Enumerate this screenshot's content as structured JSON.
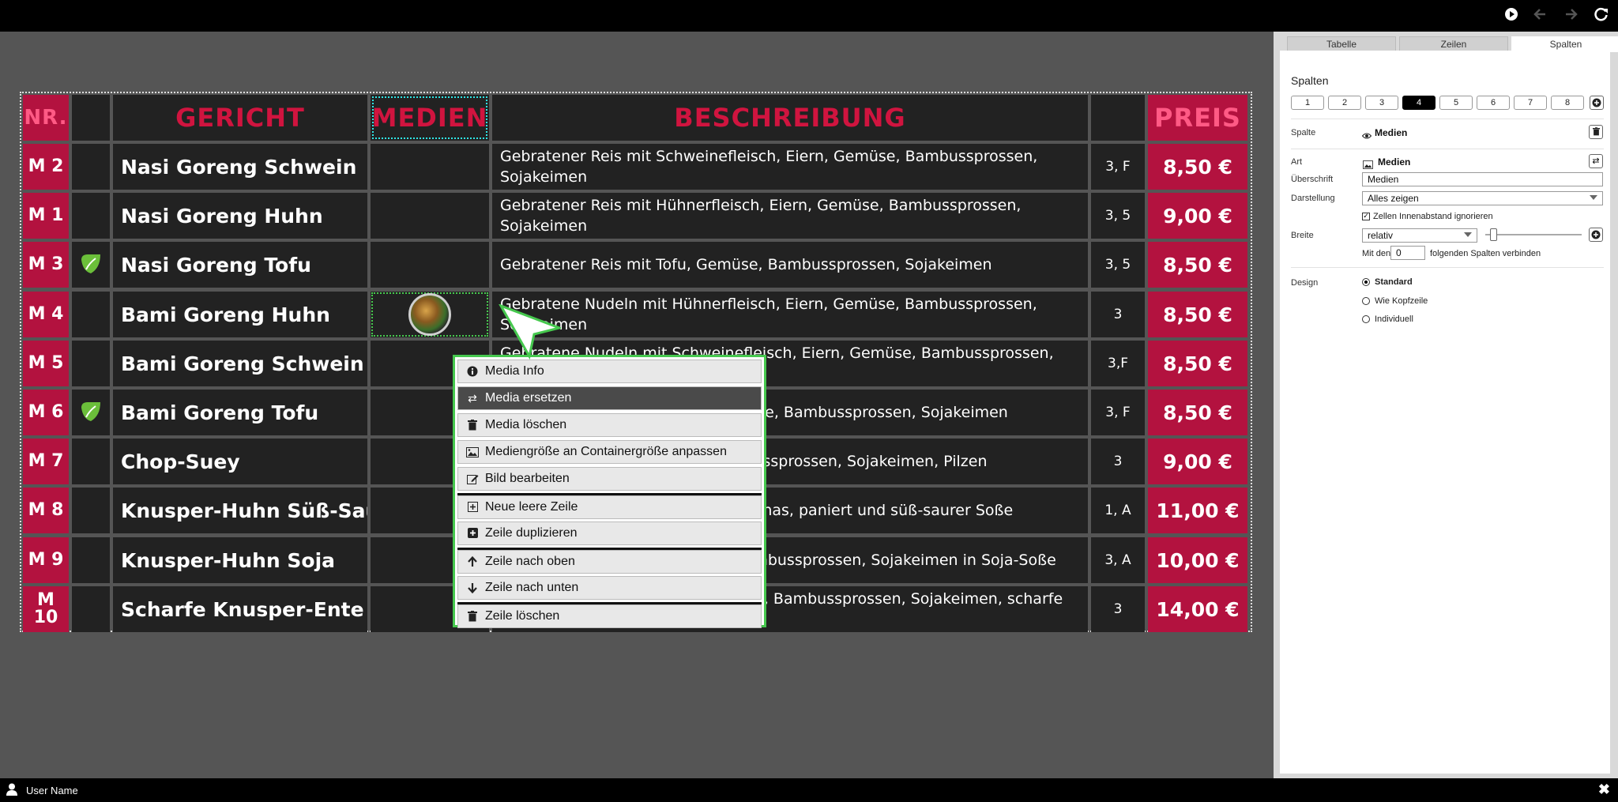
{
  "topbar": {
    "icons": [
      "play-icon",
      "back-arrow-icon",
      "forward-arrow-icon",
      "refresh-icon"
    ]
  },
  "user": {
    "name": "User Name"
  },
  "table": {
    "col_numbers": [
      "1",
      "2",
      "3",
      "4",
      "5",
      "6",
      "7"
    ],
    "headers": {
      "nr": "NR.",
      "gericht": "GERICHT",
      "medien": "MEDIEN",
      "beschreibung": "BESCHREIBUNG",
      "preis": "PREIS"
    },
    "rows": [
      {
        "nr": "M 2",
        "vegan": false,
        "gericht": "Nasi Goreng Schwein",
        "beschreibung": "Gebratener Reis mit Schweinefleisch, Eiern, Gemüse, Bambussprossen, Sojakeimen",
        "allergene": "3, F",
        "preis": "8,50 €"
      },
      {
        "nr": "M 1",
        "vegan": false,
        "gericht": "Nasi Goreng Huhn",
        "beschreibung": "Gebratener Reis mit Hühnerfleisch, Eiern, Gemüse, Bambussprossen, Sojakeimen",
        "allergene": "3, 5",
        "preis": "9,00 €"
      },
      {
        "nr": "M 3",
        "vegan": true,
        "gericht": "Nasi Goreng Tofu",
        "beschreibung": "Gebratener Reis mit Tofu, Gemüse, Bambussprossen, Sojakeimen",
        "allergene": "3, 5",
        "preis": "8,50 €"
      },
      {
        "nr": "M 4",
        "vegan": false,
        "gericht": "Bami Goreng Huhn",
        "beschreibung": "Gebratene Nudeln mit Hühnerfleisch, Eiern, Gemüse, Bambussprossen, Sojakeimen",
        "allergene": "3",
        "preis": "8,50 €"
      },
      {
        "nr": "M 5",
        "vegan": false,
        "gericht": "Bami Goreng Schwein",
        "beschreibung": "Gebratene Nudeln mit Schweinefleisch, Eiern, Gemüse, Bambussprossen, Sojakeimen",
        "allergene": "3,F",
        "preis": "8,50 €"
      },
      {
        "nr": "M 6",
        "vegan": true,
        "gericht": "Bami Goreng Tofu",
        "beschreibung": "Gebratene Nudeln mit Tofu, Gemüse, Bambussprossen, Sojakeimen",
        "allergene": "3, F",
        "preis": "8,50 €"
      },
      {
        "nr": "M 7",
        "vegan": false,
        "gericht": "Chop-Suey",
        "beschreibung": "Hühnerfleisch mit Gemüse, Bambussprossen, Sojakeimen, Pilzen",
        "allergene": "3",
        "preis": "9,00 €"
      },
      {
        "nr": "M 8",
        "vegan": false,
        "gericht": "Knusper-Huhn Süß-Saurer",
        "beschreibung": "Knuspriges Huhn mit Gemüse, Ananas, paniert und süß-saurer Soße",
        "allergene": "1, A",
        "preis": "11,00 €"
      },
      {
        "nr": "M 9",
        "vegan": false,
        "gericht": "Knusper-Huhn Soja",
        "beschreibung": "Knuspriges Huhn mit Gemüse, Bambussprossen, Sojakeimen in Soja-Soße",
        "allergene": "3, A",
        "preis": "10,00 €"
      },
      {
        "nr": "M 10",
        "vegan": false,
        "gericht": "Scharfe Knusper-Ente",
        "beschreibung": "Reis mit gebackener Ente, Gemüse, Bambussprossen, Sojakeimen, scharfe Soße",
        "allergene": "3",
        "preis": "14,00 €"
      }
    ]
  },
  "context_menu": {
    "items": [
      {
        "label": "Media Info",
        "icon": "info-icon"
      },
      {
        "label": "Media ersetzen",
        "icon": "swap-icon"
      },
      {
        "label": "Media löschen",
        "icon": "trash-icon"
      },
      {
        "label": "Mediengröße an Containergröße anpassen",
        "icon": "image-icon"
      },
      {
        "label": "Bild bearbeiten",
        "icon": "edit-icon"
      },
      {
        "label": "Neue leere Zeile",
        "icon": "plus-square-icon"
      },
      {
        "label": "Zeile duplizieren",
        "icon": "plus-square-filled-icon"
      },
      {
        "label": "Zeile nach oben",
        "icon": "arrow-up-icon"
      },
      {
        "label": "Zeile nach unten",
        "icon": "arrow-down-icon"
      },
      {
        "label": "Zeile löschen",
        "icon": "trash-icon"
      }
    ]
  },
  "panel": {
    "tabs": [
      "Tabelle",
      "Zeilen",
      "Spalten"
    ],
    "active_tab": "Spalten",
    "title": "Spalten",
    "col_buttons": [
      "1",
      "2",
      "3",
      "4",
      "5",
      "6",
      "7",
      "8"
    ],
    "active_col": "4",
    "spalte_label": "Spalte",
    "spalte_value": "Medien",
    "art_label": "Art",
    "art_value": "Medien",
    "ueberschrift_label": "Überschrift",
    "ueberschrift_value": "Medien",
    "darstellung_label": "Darstellung",
    "darstellung_value": "Alles zeigen",
    "zellen_checkbox": "Zellen Innenabstand ignorieren",
    "breite_label": "Breite",
    "breite_value": "relativ",
    "merge_prefix": "Mit den",
    "merge_value": "0",
    "merge_suffix": "folgenden Spalten verbinden",
    "design_label": "Design",
    "design_options": [
      "Standard",
      "Wie Kopfzeile",
      "Individuell"
    ],
    "design_selected": "Standard"
  },
  "colors": {
    "accent_red": "#b3123f",
    "header_text_red": "#d0143f",
    "selection_green": "#46c84e",
    "selection_cyan": "#2ee6e6"
  }
}
